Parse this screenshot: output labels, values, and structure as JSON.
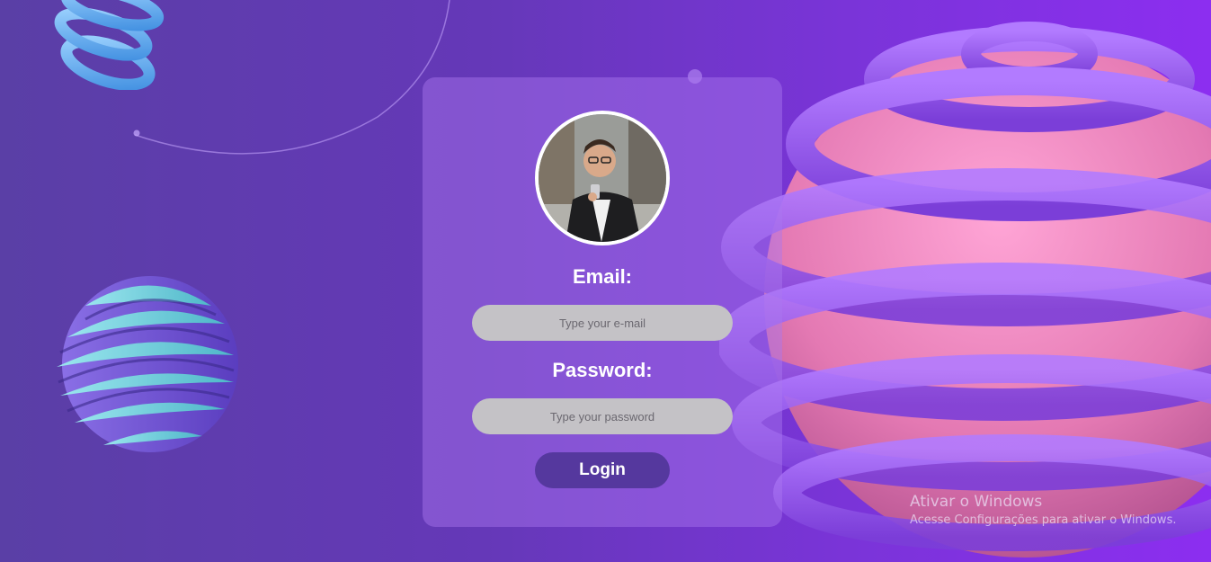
{
  "login_form": {
    "email_label": "Email:",
    "email_placeholder": "Type your e-mail",
    "password_label": "Password:",
    "password_placeholder": "Type your password",
    "login_button": "Login"
  },
  "windows_watermark": {
    "title": "Ativar o Windows",
    "subtitle": "Acesse Configurações para ativar o Windows."
  },
  "decorations": {
    "top_left": "blue-coil-shape",
    "left": "striped-sphere-shape",
    "right": "pink-ringed-sphere-shape",
    "avatar": "profile-photo"
  },
  "colors": {
    "background_left": "#5a3fa6",
    "background_right": "#8c2ef0",
    "card": "#a978f0",
    "input": "#c4c2c6",
    "button": "#55389e",
    "text": "#ffffff"
  }
}
